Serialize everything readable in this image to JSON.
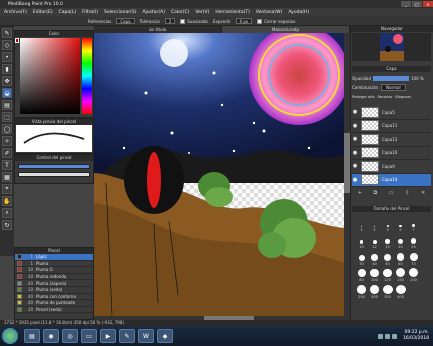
{
  "window": {
    "title": "MediBang Paint Pro 10.0",
    "min": "_",
    "max": "□",
    "close": "✕"
  },
  "menu": [
    "Archivo(F)",
    "Editar(E)",
    "Capa(L)",
    "Filtro(I)",
    "Seleccionar(S)",
    "Ajustar(A)",
    "Color(C)",
    "Ver(V)",
    "Herramienta(T)",
    "Ventana(W)",
    "Ayuda(H)"
  ],
  "toolopts": {
    "ref_label": "Referencias",
    "ref_value": "Capa",
    "tol_label": "Tolerancia",
    "tol_value": "2",
    "suav_label": "Suavizado",
    "expand_label": "Expandir",
    "expand_value": "0 px",
    "close_label": "Cerrar espacios"
  },
  "tabs": [
    "sin titulo",
    "Mascara.mdp"
  ],
  "panels": {
    "color": "Color",
    "brush_preview": "Vista previa del pincel",
    "brush_size": "Control del pincel",
    "brush_list": "Pincel",
    "navigator": "Navegador",
    "layers": "Capa",
    "brush_size_panel": "Tamaño del Pincel"
  },
  "brushes": [
    {
      "num": "1",
      "name": "Lápiz",
      "color": "#222222",
      "sel": true
    },
    {
      "num": "1",
      "name": "Pluma",
      "color": "#b03030"
    },
    {
      "num": "10",
      "name": "Pluma G",
      "color": "#b03030"
    },
    {
      "num": "10",
      "name": "Pluma redonda",
      "color": "#b03030"
    },
    {
      "num": "40",
      "name": "Pluma (áspera)",
      "color": "#8a8a8a"
    },
    {
      "num": "10",
      "name": "Pluma (seda)",
      "color": "#5a8a3a"
    },
    {
      "num": "40",
      "name": "Pluma con contorno",
      "color": "#d4c030"
    },
    {
      "num": "40",
      "name": "Pluma de punteado",
      "color": "#d4c030"
    },
    {
      "num": "10",
      "name": "Pincel (seda)",
      "color": "#5a8a3a"
    }
  ],
  "layers": {
    "opacity_label": "Opacidad",
    "opacity_value": "100 %",
    "blend_label": "Combinación",
    "blend_value": "Normal",
    "protect_label": "Proteger alfa",
    "clip_label": "Recortar",
    "lock_label": "Bloquear",
    "items": [
      {
        "name": "Capa5"
      },
      {
        "name": "Capa11"
      },
      {
        "name": "Capa13"
      },
      {
        "name": "Capa10"
      },
      {
        "name": "Capa9"
      },
      {
        "name": "Capa14",
        "sel": true
      }
    ]
  },
  "brush_sizes": [
    "1",
    "2",
    "3",
    "5",
    "7",
    "10",
    "12",
    "15",
    "20",
    "25",
    "30",
    "40",
    "50",
    "60",
    "70",
    "80",
    "100",
    "120",
    "150",
    "200",
    "250",
    "300",
    "350",
    "400"
  ],
  "status": "1732 * 1935 pixel (11.8 * 16.8cm) 350 dpi 50 % (-932, 798)",
  "clock": {
    "time": "09:22 p.m.",
    "date": "16/03/2018"
  }
}
